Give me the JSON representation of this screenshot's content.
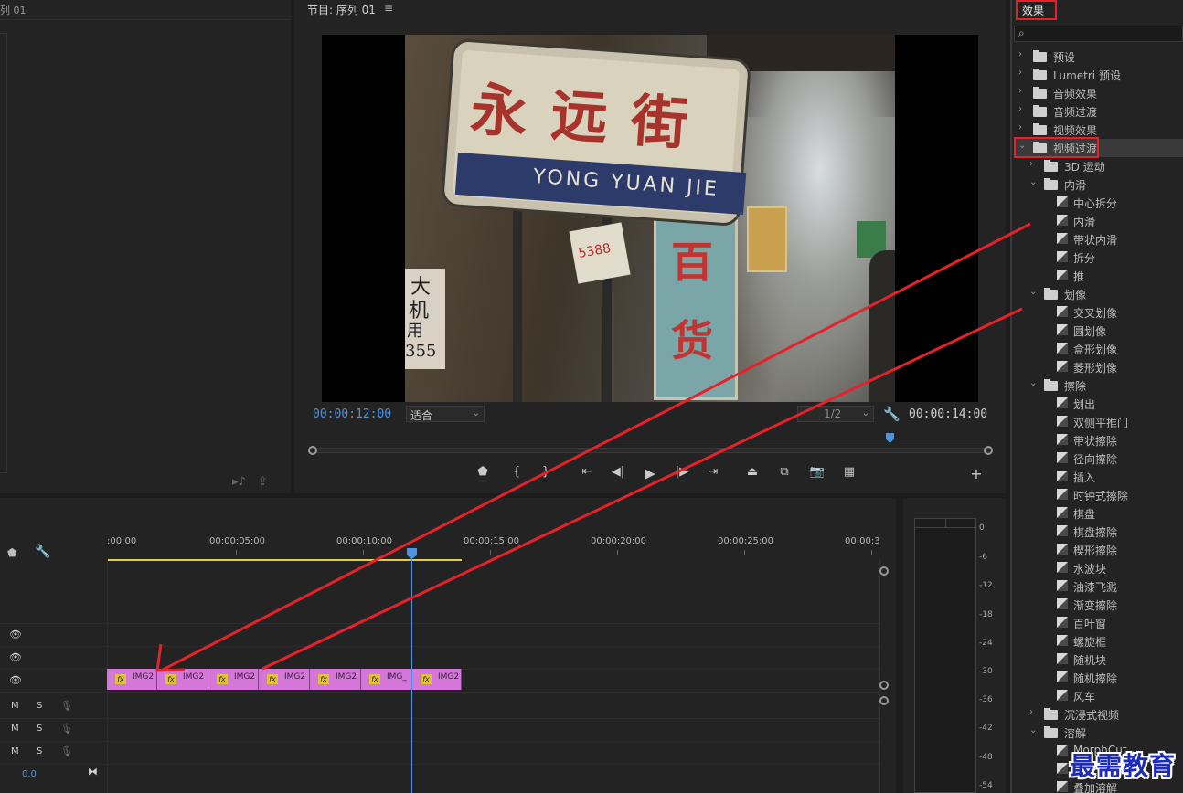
{
  "source": {
    "title_fragment": "列 01"
  },
  "program": {
    "title": "节目: 序列 01",
    "menu_icon": "≡",
    "timecode_current": "00:00:12:00",
    "timecode_duration": "00:00:14:00",
    "zoom": "适合",
    "resolution": "1/2",
    "video": {
      "sign_chinese": "永远街",
      "sign_english": "YONG YUAN JIE",
      "banner_chars": [
        "百",
        "货"
      ],
      "left_sign_chars": [
        "大",
        "机",
        "用",
        "355"
      ],
      "paper_text": "5388"
    }
  },
  "timeline": {
    "ruler_labels": [
      ":00:00",
      "00:00:05:00",
      "00:00:10:00",
      "00:00:15:00",
      "00:00:20:00",
      "00:00:25:00",
      "00:00:3"
    ],
    "audio_level": "0.0",
    "clip_names": [
      "IMG2",
      "IMG2",
      "IMG2",
      "IMG2",
      "IMG2",
      "IMG_",
      "IMG2"
    ],
    "clip_fx": "fx",
    "audio_track_buttons": {
      "mute": "M",
      "solo": "S"
    }
  },
  "meter": {
    "labels": [
      "0",
      "-6",
      "-12",
      "-18",
      "-24",
      "-30",
      "-36",
      "-42",
      "-48",
      "-54"
    ]
  },
  "effects": {
    "title": "效果",
    "tree": [
      {
        "label": "预设",
        "type": "preset-folder",
        "level": 0,
        "arrow": "›"
      },
      {
        "label": "Lumetri 预设",
        "type": "preset-folder",
        "level": 0,
        "arrow": "›"
      },
      {
        "label": "音频效果",
        "type": "folder",
        "level": 0,
        "arrow": "›"
      },
      {
        "label": "音频过渡",
        "type": "folder",
        "level": 0,
        "arrow": "›"
      },
      {
        "label": "视频效果",
        "type": "folder",
        "level": 0,
        "arrow": "›"
      },
      {
        "label": "视频过渡",
        "type": "folder",
        "level": 0,
        "arrow": "⌄",
        "selected": true
      },
      {
        "label": "3D 运动",
        "type": "folder",
        "level": 1,
        "arrow": "›"
      },
      {
        "label": "内滑",
        "type": "folder",
        "level": 1,
        "arrow": "⌄"
      },
      {
        "label": "中心拆分",
        "type": "effect",
        "level": 2
      },
      {
        "label": "内滑",
        "type": "effect",
        "level": 2
      },
      {
        "label": "带状内滑",
        "type": "effect",
        "level": 2
      },
      {
        "label": "拆分",
        "type": "effect",
        "level": 2
      },
      {
        "label": "推",
        "type": "effect",
        "level": 2
      },
      {
        "label": "划像",
        "type": "folder",
        "level": 1,
        "arrow": "⌄"
      },
      {
        "label": "交叉划像",
        "type": "effect",
        "level": 2
      },
      {
        "label": "圆划像",
        "type": "effect",
        "level": 2
      },
      {
        "label": "盒形划像",
        "type": "effect",
        "level": 2
      },
      {
        "label": "菱形划像",
        "type": "effect",
        "level": 2
      },
      {
        "label": "擦除",
        "type": "folder",
        "level": 1,
        "arrow": "⌄"
      },
      {
        "label": "划出",
        "type": "effect",
        "level": 2
      },
      {
        "label": "双侧平推门",
        "type": "effect",
        "level": 2
      },
      {
        "label": "带状擦除",
        "type": "effect",
        "level": 2
      },
      {
        "label": "径向擦除",
        "type": "effect",
        "level": 2
      },
      {
        "label": "插入",
        "type": "effect",
        "level": 2
      },
      {
        "label": "时钟式擦除",
        "type": "effect",
        "level": 2
      },
      {
        "label": "棋盘",
        "type": "effect",
        "level": 2
      },
      {
        "label": "棋盘擦除",
        "type": "effect",
        "level": 2
      },
      {
        "label": "楔形擦除",
        "type": "effect",
        "level": 2
      },
      {
        "label": "水波块",
        "type": "effect",
        "level": 2
      },
      {
        "label": "油漆飞溅",
        "type": "effect",
        "level": 2
      },
      {
        "label": "渐变擦除",
        "type": "effect",
        "level": 2
      },
      {
        "label": "百叶窗",
        "type": "effect",
        "level": 2
      },
      {
        "label": "螺旋框",
        "type": "effect",
        "level": 2
      },
      {
        "label": "随机块",
        "type": "effect",
        "level": 2
      },
      {
        "label": "随机擦除",
        "type": "effect",
        "level": 2
      },
      {
        "label": "风车",
        "type": "effect",
        "level": 2
      },
      {
        "label": "沉浸式视频",
        "type": "folder",
        "level": 1,
        "arrow": "›"
      },
      {
        "label": "溶解",
        "type": "folder",
        "level": 1,
        "arrow": "⌄"
      },
      {
        "label": "MorphCut",
        "type": "effect",
        "level": 2
      },
      {
        "label": "",
        "type": "effect",
        "level": 2
      },
      {
        "label": "叠加溶解",
        "type": "effect",
        "level": 2
      }
    ]
  },
  "watermark": "最需教育",
  "colors": {
    "annotation_red": "#e5222a",
    "playhead_blue": "#4c93e4",
    "clip_pink": "#d477d9",
    "work_area_yellow": "#e3cf3c"
  }
}
